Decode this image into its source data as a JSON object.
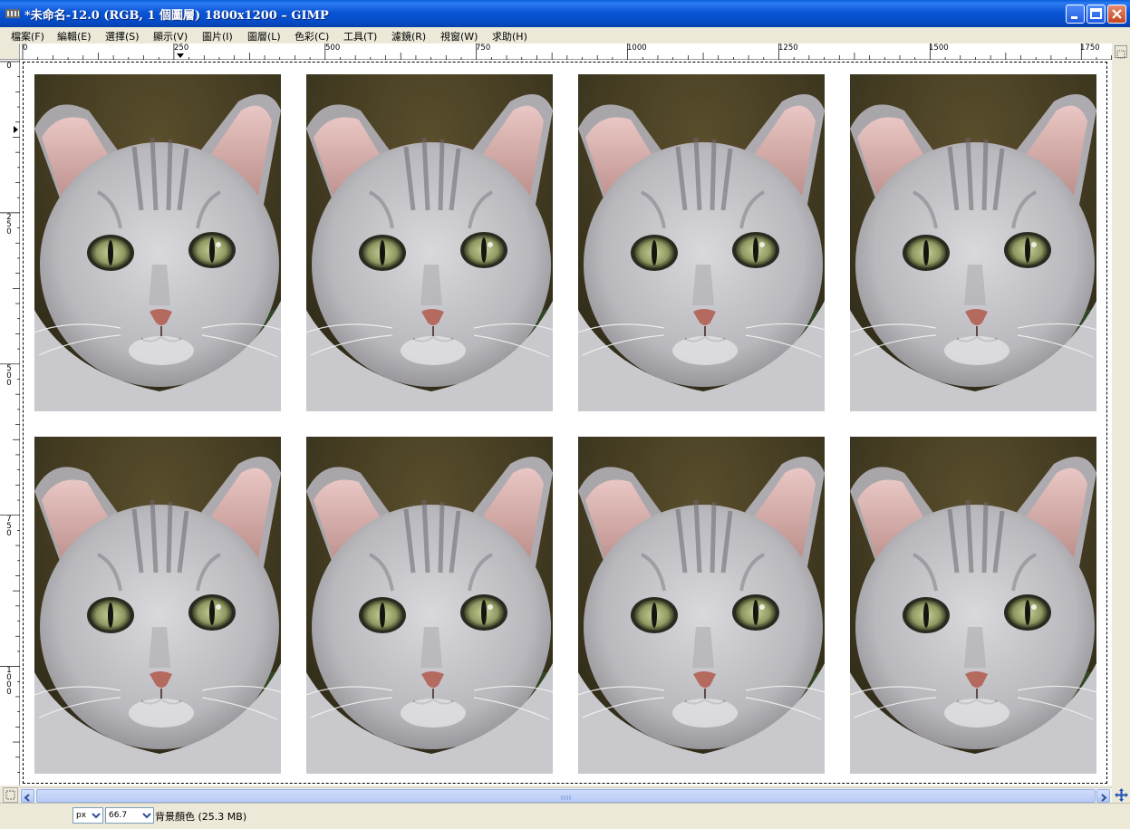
{
  "window": {
    "title": "*未命名-12.0 (RGB, 1 個圖層) 1800x1200  –  GIMP"
  },
  "menu": [
    {
      "label": "檔案(F)"
    },
    {
      "label": "編輯(E)"
    },
    {
      "label": "選擇(S)"
    },
    {
      "label": "顯示(V)"
    },
    {
      "label": "圖片(I)"
    },
    {
      "label": "圖層(L)"
    },
    {
      "label": "色彩(C)"
    },
    {
      "label": "工具(T)"
    },
    {
      "label": "濾鏡(R)"
    },
    {
      "label": "視窗(W)"
    },
    {
      "label": "求助(H)"
    }
  ],
  "ruler_h": [
    "0",
    "250",
    "500",
    "750",
    "1000",
    "1250",
    "1500",
    "1750"
  ],
  "ruler_v": [
    "0",
    "250",
    "500",
    "750",
    "1000"
  ],
  "canvas": {
    "photo_subject": "tabby cat face portrait",
    "photo_count": 8,
    "background_color": "#ffffff"
  },
  "status": {
    "unit": "px",
    "zoom": "66.7",
    "info": "背景顏色 (25.3 MB)"
  },
  "colors": {
    "titlebar": "#0a55d6",
    "chrome": "#ece9d8"
  }
}
